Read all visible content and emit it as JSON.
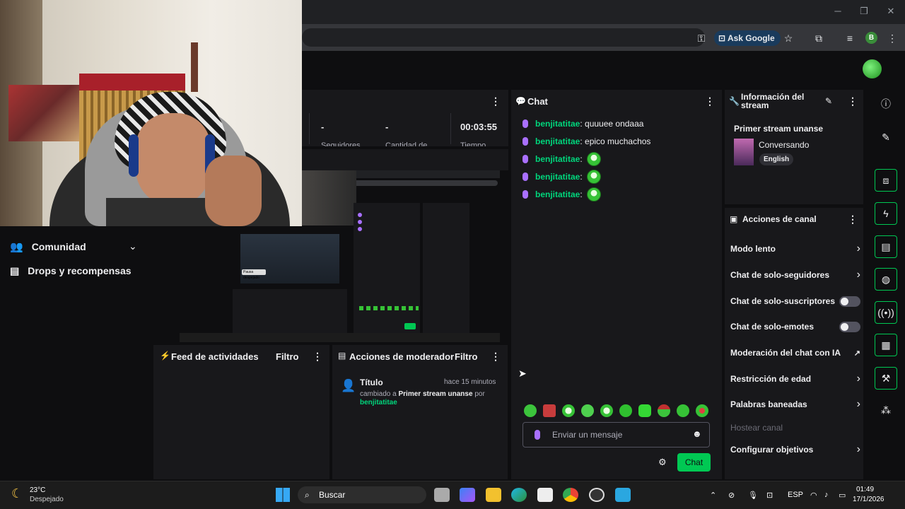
{
  "browser": {
    "ask_google": "Ask Google",
    "profile_initial": "B"
  },
  "sidebar": {
    "items": [
      {
        "label": "Comunidad"
      },
      {
        "label": "Drops y recompensas"
      }
    ]
  },
  "stats": {
    "values": [
      "-",
      "-",
      "00:03:55"
    ],
    "labels": [
      "Seguidores",
      "Cantidad de",
      "Tiempo"
    ]
  },
  "preview": {
    "tooltip": "Pausa despejado"
  },
  "activity_feed": {
    "title": "Feed de actividades",
    "filter": "Filtro"
  },
  "mod_actions": {
    "title": "Acciones de moderador",
    "filter": "Filtro",
    "event_title": "Título",
    "event_time": "hace 15 minutos",
    "event_prefix": "cambiado a",
    "event_value": "Primer stream unanse",
    "event_by": "por",
    "event_user": "benjitatitae"
  },
  "chat": {
    "title": "Chat",
    "messages": [
      {
        "user": "benjitatitae",
        "text": ": quuuee ondaaa"
      },
      {
        "user": "benjitatitae",
        "text": ": epico muchachos"
      },
      {
        "user": "benjitatitae",
        "text": ":"
      },
      {
        "user": "benjitatitae",
        "text": ":"
      },
      {
        "user": "benjitatitae",
        "text": ":"
      }
    ],
    "input_placeholder": "Enviar un mensaje",
    "send_label": "Chat"
  },
  "stream_info": {
    "title": "Información del stream",
    "stream_title": "Primer stream unanse",
    "category": "Conversando",
    "tag": "English"
  },
  "channel_actions": {
    "title": "Acciones de canal",
    "items": [
      {
        "label": "Modo lento"
      },
      {
        "label": "Chat de solo-seguidores"
      },
      {
        "label": "Chat de solo-suscriptores"
      },
      {
        "label": "Chat de solo-emotes"
      },
      {
        "label": "Moderación del chat con IA"
      },
      {
        "label": "Restricción de edad"
      },
      {
        "label": "Palabras baneadas"
      },
      {
        "label": "Hostear canal"
      },
      {
        "label": "Configurar objetivos"
      }
    ]
  },
  "taskbar": {
    "weather_temp": "23°C",
    "weather_desc": "Despejado",
    "search_label": "Buscar",
    "lang": "ESP",
    "time": "01:49",
    "date": "17/1/2026"
  },
  "colors": {
    "accent": "#00c853",
    "username": "#00d67c",
    "mic": "#a970ff",
    "panel": "#18181b",
    "background": "#0e0e10"
  }
}
